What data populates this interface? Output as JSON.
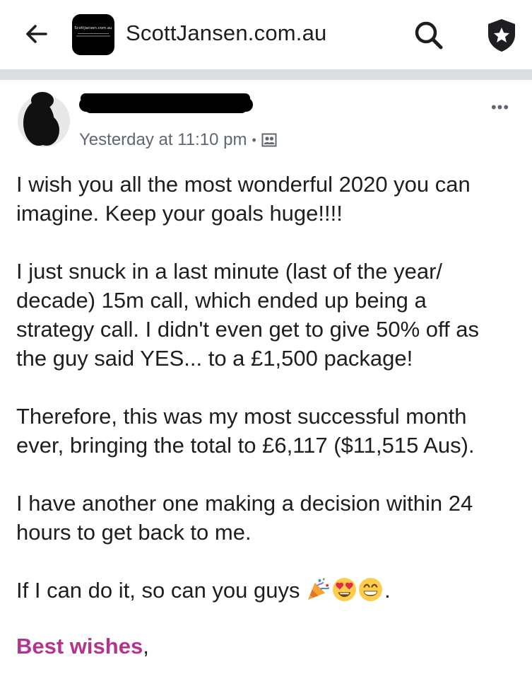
{
  "header": {
    "title": "ScottJansen.com.au",
    "logo_text": "ScottJansen.com.au",
    "back_icon": "arrow-left-icon",
    "search_icon": "search-icon",
    "shield_icon": "shield-star-icon"
  },
  "post": {
    "author_name": "",
    "timestamp": "Yesterday at 11:10 pm",
    "separator": "•",
    "audience_icon": "group-audience-icon",
    "more_label": "•••",
    "paragraphs": [
      "I wish you all the most wonderful 2020 you can\nimagine. Keep your goals huge!!!!",
      "I just snuck in a last minute (last of the year/\ndecade) 15m call, which ended up being a\nstrategy call. I didn't even get to give 50% off as\nthe guy said YES... to a £1,500 package!",
      "Therefore, this was my most successful month\never, bringing the total to £6,117 ($11,515 Aus).",
      "I have another one making a decision within 24\nhours to get back to me."
    ],
    "last_line": "If I can do it, so can you guys",
    "last_line_end": ".",
    "emojis": [
      "party-popper-icon",
      "heart-eyes-icon",
      "grin-icon"
    ],
    "signoff_name": "Best wishes",
    "signoff_comma": ","
  },
  "colors": {
    "divider": "#dadde1",
    "meta_text": "#606770",
    "signoff": "#b3348f"
  }
}
